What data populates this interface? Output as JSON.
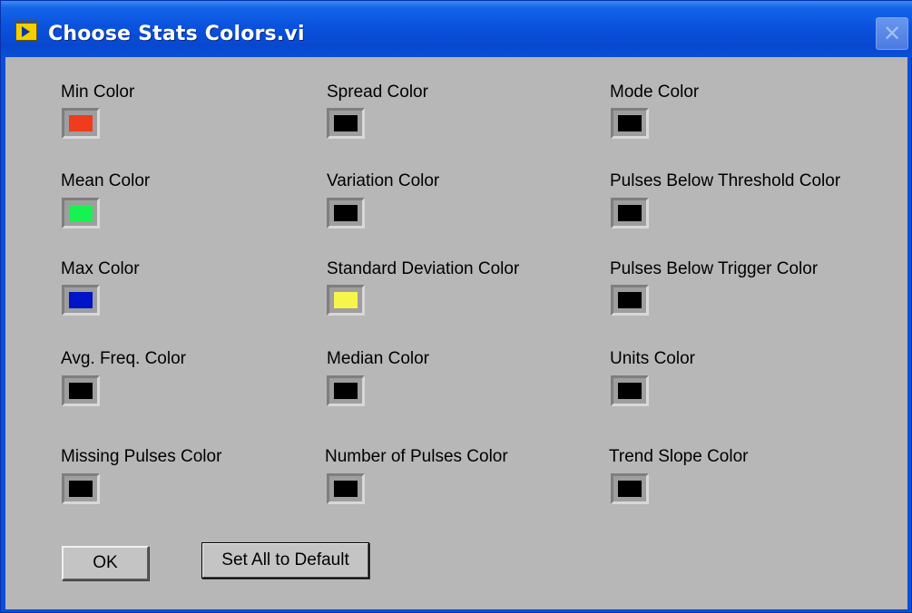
{
  "window": {
    "title": "Choose Stats Colors.vi",
    "close_glyph": "✕"
  },
  "colors": [
    {
      "label": "Min Color",
      "value": "#f03c1e"
    },
    {
      "label": "Spread Color",
      "value": "#000000"
    },
    {
      "label": "Mode Color",
      "value": "#000000"
    },
    {
      "label": "Mean Color",
      "value": "#16f250"
    },
    {
      "label": "Variation Color",
      "value": "#000000"
    },
    {
      "label": "Pulses Below Threshold Color",
      "value": "#000000"
    },
    {
      "label": "Max Color",
      "value": "#0014c8"
    },
    {
      "label": "Standard Deviation Color",
      "value": "#f6f64a"
    },
    {
      "label": "Pulses Below Trigger Color",
      "value": "#000000"
    },
    {
      "label": "Avg. Freq. Color",
      "value": "#000000"
    },
    {
      "label": "Median Color",
      "value": "#000000"
    },
    {
      "label": "Units Color",
      "value": "#000000"
    },
    {
      "label": "Missing Pulses Color",
      "value": "#000000"
    },
    {
      "label": "Number of Pulses Color",
      "value": "#000000"
    },
    {
      "label": "Trend Slope Color",
      "value": "#000000"
    }
  ],
  "buttons": {
    "ok": "OK",
    "set_default": "Set All to Default"
  }
}
